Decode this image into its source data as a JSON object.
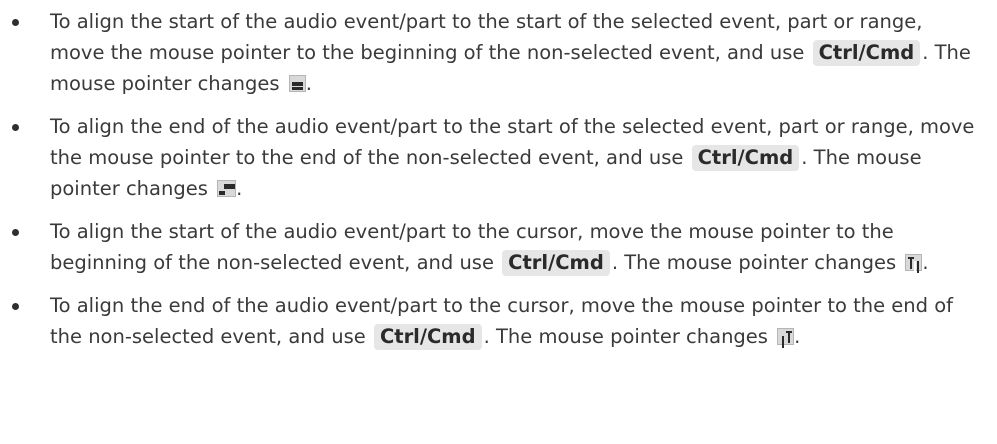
{
  "items": [
    {
      "before": "To align the start of the audio event/part to the start of the selected event, part or range, move the mouse pointer to the beginning of the non-selected event, and use ",
      "key": "Ctrl/Cmd",
      "after": ". The mouse pointer changes ",
      "icon": "align-start-to-selection-pointer-icon",
      "end": "."
    },
    {
      "before": "To align the end of the audio event/part to the start of the selected event, part or range, move the mouse pointer to the end of the non-selected event, and use ",
      "key": "Ctrl/Cmd",
      "after": ". The mouse pointer changes ",
      "icon": "align-end-to-selection-pointer-icon",
      "end": "."
    },
    {
      "before": "To align the start of the audio event/part to the cursor, move the mouse pointer to the beginning of the non-selected event, and use ",
      "key": "Ctrl/Cmd",
      "after": ". The mouse pointer changes ",
      "icon": "align-start-to-cursor-pointer-icon",
      "end": "."
    },
    {
      "before": "To align the end of the audio event/part to the cursor, move the mouse pointer to the end of the non-selected event, and use ",
      "key": "Ctrl/Cmd",
      "after": ". The mouse pointer changes ",
      "icon": "align-end-to-cursor-pointer-icon",
      "end": "."
    }
  ]
}
